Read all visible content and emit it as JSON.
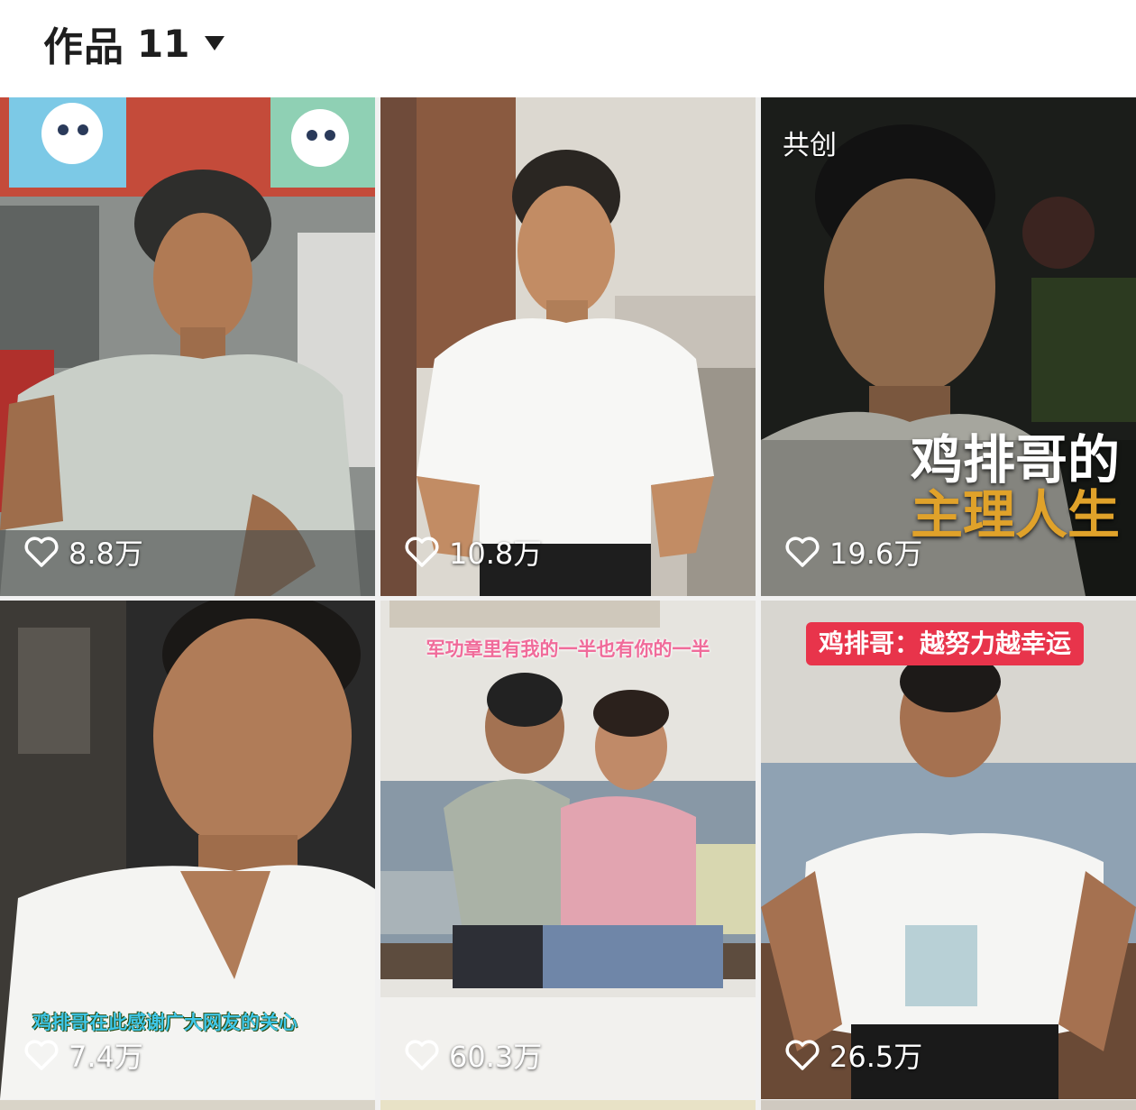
{
  "header": {
    "tab_label": "作品",
    "tab_count": "11",
    "dropdown_icon": "caret-down-icon"
  },
  "videos": [
    {
      "likes": "8.8万"
    },
    {
      "likes": "10.8万",
      "colab_badge": ""
    },
    {
      "likes": "19.6万",
      "colab_badge": "共创",
      "title_line1": "鸡排哥的",
      "title_line2": "主理人生"
    },
    {
      "likes": "7.4万",
      "caption": "鸡排哥在此感谢广大网友的关心"
    },
    {
      "likes": "60.3万",
      "caption": "军功章里有我的一半也有你的一半"
    },
    {
      "likes": "26.5万",
      "banner": "鸡排哥：越努力越幸运"
    }
  ],
  "colors": {
    "banner_red": "#e8344b",
    "title_gold": "#e0a22a",
    "caption_pink": "#f06b9a",
    "caption_cyan": "#3ec6e8"
  },
  "icons": [
    "caret-down-icon",
    "heart-outline-icon"
  ]
}
